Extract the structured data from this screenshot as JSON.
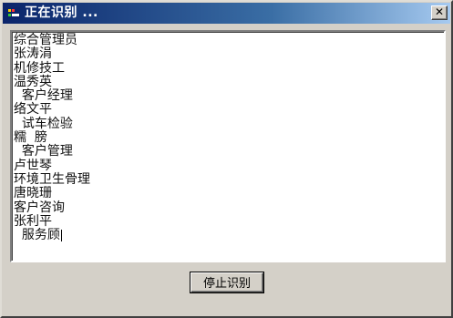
{
  "window": {
    "title": "正在识别 ..."
  },
  "recognized_text": {
    "lines": [
      "综合管理员",
      "张涛涓",
      "机修技工",
      "温秀英",
      "  客户经理",
      "络文平",
      "  试车检验",
      "糯  膀",
      "  客户管理",
      "卢世琴",
      "环境卫生骨理",
      "唐晓珊",
      "客户咨询",
      "张利平",
      "  服务顾"
    ]
  },
  "buttons": {
    "stop_label": "停止识别"
  },
  "colors": {
    "titlebar_start": "#0a246a",
    "titlebar_end": "#a6caf0",
    "dialog_face": "#d4d0c8"
  },
  "icons": {
    "app_icon": "app-icon",
    "close": "close-icon"
  }
}
